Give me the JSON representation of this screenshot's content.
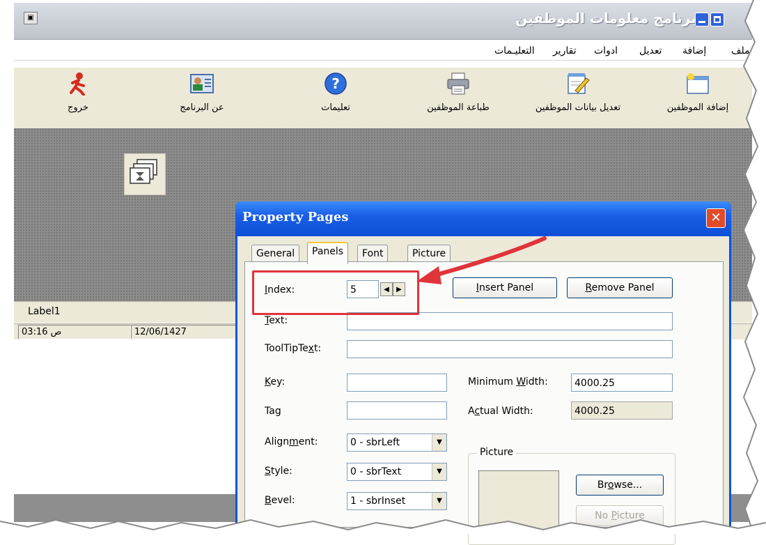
{
  "app": {
    "title": "برنامج معلومات الموظفين",
    "menu": [
      "التعليـمات",
      "تقارير",
      "ادوات",
      "تعديل",
      "إضافة",
      "ملف"
    ],
    "toolbar": [
      {
        "label": "خروج",
        "icon": "exit-runner-icon"
      },
      {
        "label": "عن البرنامج",
        "icon": "about-card-icon"
      },
      {
        "label": "تعليمات",
        "icon": "help-icon"
      },
      {
        "label": "طباعة الموظفين",
        "icon": "printer-icon"
      },
      {
        "label": "تعديل بيانات الموظفين",
        "icon": "edit-notepad-icon"
      },
      {
        "label": "إضافة الموظفين",
        "icon": "add-folder-icon"
      }
    ],
    "label1": "Label1",
    "status": {
      "time": "ص 03:16",
      "date": "12/06/1427"
    }
  },
  "dialog": {
    "title": "Property Pages",
    "tabs": [
      "General",
      "Panels",
      "Font",
      "Picture"
    ],
    "active_tab": "Panels",
    "index": {
      "label_pre": "",
      "label_u": "I",
      "label_post": "ndex:",
      "value": "5"
    },
    "insert_button": {
      "u": "I",
      "rest": "nsert Panel"
    },
    "remove_button": {
      "u": "R",
      "rest": "emove Panel"
    },
    "text": {
      "u": "T",
      "rest": "ext:",
      "value": ""
    },
    "tooltip": {
      "pre": "ToolTipTe",
      "u": "x",
      "rest": "t:",
      "value": ""
    },
    "key": {
      "u": "K",
      "rest": "ey:",
      "value": ""
    },
    "tag": {
      "label": "Tag",
      "value": ""
    },
    "min_width": {
      "pre": "Minimum ",
      "u": "W",
      "rest": "idth:",
      "value": "4000.25"
    },
    "actual_width": {
      "pre": "A",
      "u": "c",
      "rest": "tual Width:",
      "value": "4000.25"
    },
    "alignment": {
      "pre": "Align",
      "u": "m",
      "rest": "ent:",
      "value": "0 - sbrLeft"
    },
    "style": {
      "u": "S",
      "rest": "tyle:",
      "value": "0 - sbrText"
    },
    "bevel": {
      "u": "B",
      "rest": "evel:",
      "value": "1 - sbrInset"
    },
    "picture_group": "Picture",
    "browse_button": {
      "pre": "Br",
      "u": "o",
      "rest": "wse..."
    },
    "nopicture_button": {
      "pre": "No ",
      "u": "P",
      "rest": "icture"
    }
  },
  "colors": {
    "highlight": "#e0333a",
    "dialog_title": "#1a5fe5",
    "mdi_bg": "#8d8d8d"
  }
}
